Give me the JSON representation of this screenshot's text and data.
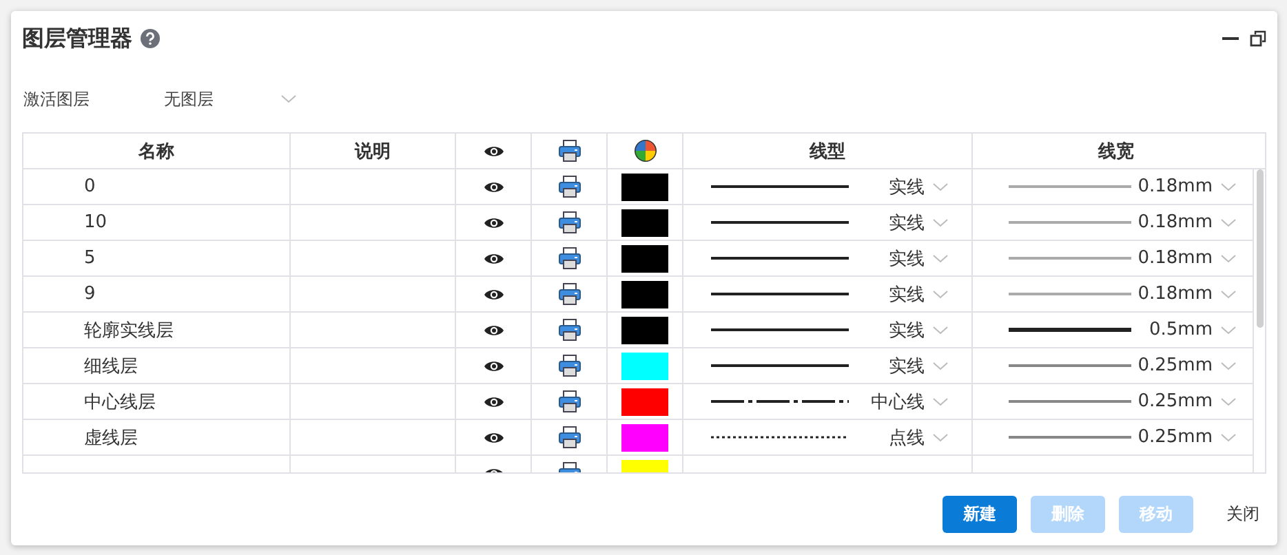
{
  "window": {
    "title": "图层管理器"
  },
  "active_layer": {
    "label": "激活图层",
    "value": "无图层"
  },
  "table": {
    "columns": [
      {
        "kind": "text",
        "label": "名称"
      },
      {
        "kind": "text",
        "label": "说明"
      },
      {
        "kind": "visibility"
      },
      {
        "kind": "print"
      },
      {
        "kind": "color"
      },
      {
        "kind": "text",
        "label": "线型"
      },
      {
        "kind": "text",
        "label": "线宽"
      }
    ],
    "rows": [
      {
        "name": "0",
        "color": "#000000",
        "linetype": {
          "kind": "solid",
          "label": "实线"
        },
        "lineweight": {
          "kind": "light",
          "label": "0.18mm"
        }
      },
      {
        "name": "10",
        "color": "#000000",
        "linetype": {
          "kind": "solid",
          "label": "实线"
        },
        "lineweight": {
          "kind": "light",
          "label": "0.18mm"
        }
      },
      {
        "name": "5",
        "color": "#000000",
        "linetype": {
          "kind": "solid",
          "label": "实线"
        },
        "lineweight": {
          "kind": "light",
          "label": "0.18mm"
        }
      },
      {
        "name": "9",
        "color": "#000000",
        "linetype": {
          "kind": "solid",
          "label": "实线"
        },
        "lineweight": {
          "kind": "light",
          "label": "0.18mm"
        }
      },
      {
        "name": "轮廓实线层",
        "color": "#000000",
        "linetype": {
          "kind": "solid",
          "label": "实线"
        },
        "lineweight": {
          "kind": "heavy",
          "label": "0.5mm"
        }
      },
      {
        "name": "细线层",
        "color": "#00ffff",
        "linetype": {
          "kind": "solid",
          "label": "实线"
        },
        "lineweight": {
          "kind": "medium",
          "label": "0.25mm"
        }
      },
      {
        "name": "中心线层",
        "color": "#ff0000",
        "linetype": {
          "kind": "center",
          "label": "中心线"
        },
        "lineweight": {
          "kind": "medium",
          "label": "0.25mm"
        }
      },
      {
        "name": "虚线层",
        "color": "#ff00ff",
        "linetype": {
          "kind": "dotted",
          "label": "点线"
        },
        "lineweight": {
          "kind": "medium",
          "label": "0.25mm"
        }
      }
    ],
    "cut_row": {
      "color": "#ffff00"
    }
  },
  "buttons": [
    {
      "label": "新建",
      "kind": "primary",
      "disabled": false
    },
    {
      "label": "删除",
      "kind": "primary",
      "disabled": true
    },
    {
      "label": "移动",
      "kind": "primary",
      "disabled": true
    },
    {
      "label": "关闭",
      "kind": "plain"
    }
  ]
}
